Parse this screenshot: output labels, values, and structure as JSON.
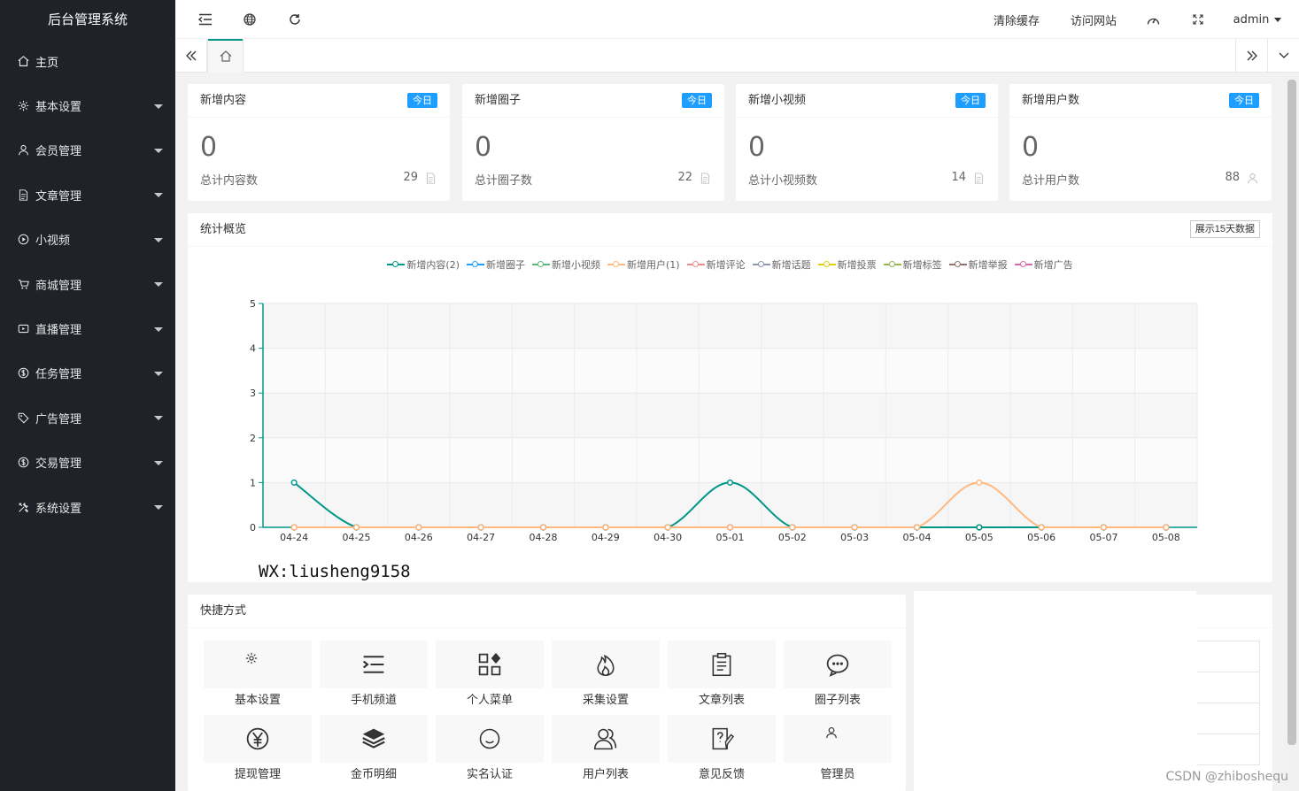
{
  "app": {
    "title": "后台管理系统"
  },
  "sidebar": {
    "items": [
      {
        "label": "主页",
        "icon": "home-icon",
        "active": true
      },
      {
        "label": "基本设置",
        "icon": "gear-icon"
      },
      {
        "label": "会员管理",
        "icon": "user-icon"
      },
      {
        "label": "文章管理",
        "icon": "document-icon"
      },
      {
        "label": "小视频",
        "icon": "play-icon"
      },
      {
        "label": "商城管理",
        "icon": "cart-icon"
      },
      {
        "label": "直播管理",
        "icon": "live-icon"
      },
      {
        "label": "任务管理",
        "icon": "dollar-icon"
      },
      {
        "label": "广告管理",
        "icon": "tag-icon"
      },
      {
        "label": "交易管理",
        "icon": "dollar-icon"
      },
      {
        "label": "系统设置",
        "icon": "tools-icon"
      }
    ]
  },
  "header": {
    "clear_cache": "清除缓存",
    "visit_site": "访问网站",
    "user": "admin"
  },
  "stats": [
    {
      "title": "新增内容",
      "badge": "今日",
      "value": "0",
      "total_label": "总计内容数",
      "total": "29",
      "icon": "document-icon"
    },
    {
      "title": "新增圈子",
      "badge": "今日",
      "value": "0",
      "total_label": "总计圈子数",
      "total": "22",
      "icon": "document-icon"
    },
    {
      "title": "新增小视频",
      "badge": "今日",
      "value": "0",
      "total_label": "总计小视频数",
      "total": "14",
      "icon": "document-icon"
    },
    {
      "title": "新增用户数",
      "badge": "今日",
      "value": "0",
      "total_label": "总计用户数",
      "total": "88",
      "icon": "user-icon"
    }
  ],
  "overview": {
    "title": "统计概览",
    "button": "展示15天数据"
  },
  "chart_data": {
    "type": "line",
    "smooth": true,
    "categories": [
      "04-24",
      "04-25",
      "04-26",
      "04-27",
      "04-28",
      "04-29",
      "04-30",
      "05-01",
      "05-02",
      "05-03",
      "05-04",
      "05-05",
      "05-06",
      "05-07",
      "05-08"
    ],
    "ylim": [
      0,
      5
    ],
    "yticks": [
      "0",
      "1",
      "2",
      "3",
      "4",
      "5"
    ],
    "grid": "striped",
    "legend_position": "top",
    "series": [
      {
        "name": "新增内容(2)",
        "color": "#009688",
        "values": [
          1,
          0,
          0,
          0,
          0,
          0,
          0,
          1,
          0,
          0,
          0,
          0,
          0,
          0,
          0
        ]
      },
      {
        "name": "新增圈子",
        "color": "#1e9fff",
        "values": [
          0,
          0,
          0,
          0,
          0,
          0,
          0,
          0,
          0,
          0,
          0,
          0,
          0,
          0,
          0
        ]
      },
      {
        "name": "新增小视频",
        "color": "#5fb878",
        "values": [
          0,
          0,
          0,
          0,
          0,
          0,
          0,
          0,
          0,
          0,
          0,
          0,
          0,
          0,
          0
        ]
      },
      {
        "name": "新增用户(1)",
        "color": "#ffb980",
        "values": [
          0,
          0,
          0,
          0,
          0,
          0,
          0,
          0,
          0,
          0,
          0,
          1,
          0,
          0,
          0
        ]
      },
      {
        "name": "新增评论",
        "color": "#e88f8f",
        "values": [
          0,
          0,
          0,
          0,
          0,
          0,
          0,
          0,
          0,
          0,
          0,
          0,
          0,
          0,
          0
        ]
      },
      {
        "name": "新增话题",
        "color": "#8d98b3",
        "values": [
          0,
          0,
          0,
          0,
          0,
          0,
          0,
          0,
          0,
          0,
          0,
          0,
          0,
          0,
          0
        ]
      },
      {
        "name": "新增投票",
        "color": "#e5cf0d",
        "values": [
          0,
          0,
          0,
          0,
          0,
          0,
          0,
          0,
          0,
          0,
          0,
          0,
          0,
          0,
          0
        ]
      },
      {
        "name": "新增标签",
        "color": "#97b552",
        "values": [
          0,
          0,
          0,
          0,
          0,
          0,
          0,
          0,
          0,
          0,
          0,
          0,
          0,
          0,
          0
        ]
      },
      {
        "name": "新增举报",
        "color": "#95706d",
        "values": [
          0,
          0,
          0,
          0,
          0,
          0,
          0,
          0,
          0,
          0,
          0,
          0,
          0,
          0,
          0
        ]
      },
      {
        "name": "新增广告",
        "color": "#dc69aa",
        "values": [
          0,
          0,
          0,
          0,
          0,
          0,
          0,
          0,
          0,
          0,
          0,
          0,
          0,
          0,
          0
        ]
      }
    ]
  },
  "watermark": "WX:liusheng9158",
  "quick": {
    "title": "快捷方式",
    "items": [
      {
        "label": "基本设置",
        "icon": "gear-icon"
      },
      {
        "label": "手机频道",
        "icon": "menu-indent-icon"
      },
      {
        "label": "个人菜单",
        "icon": "apps-icon"
      },
      {
        "label": "采集设置",
        "icon": "fire-icon"
      },
      {
        "label": "文章列表",
        "icon": "clipboard-icon"
      },
      {
        "label": "圈子列表",
        "icon": "chat-icon"
      },
      {
        "label": "提现管理",
        "icon": "yen-icon"
      },
      {
        "label": "金币明细",
        "icon": "layers-icon"
      },
      {
        "label": "实名认证",
        "icon": "smile-icon"
      },
      {
        "label": "用户列表",
        "icon": "users-icon"
      },
      {
        "label": "意见反馈",
        "icon": "feedback-icon"
      },
      {
        "label": "管理员",
        "icon": "user-icon"
      }
    ]
  },
  "footer_watermark": "CSDN @zhiboshequ"
}
